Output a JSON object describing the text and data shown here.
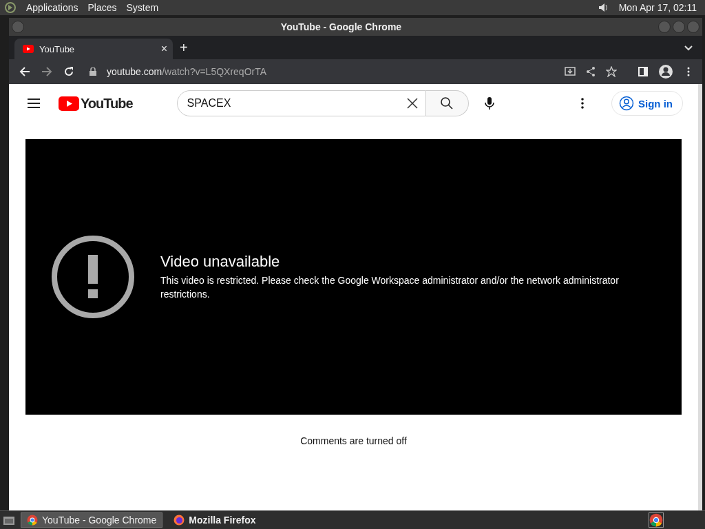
{
  "top_panel": {
    "menus": [
      "Applications",
      "Places",
      "System"
    ],
    "clock": "Mon Apr 17, 02:11"
  },
  "window": {
    "title": "YouTube - Google Chrome"
  },
  "tabs": [
    {
      "label": "YouTube",
      "selected": true,
      "close": "×"
    }
  ],
  "new_tab": "+",
  "address_bar": {
    "domain": "youtube.com",
    "path": "/watch?v=L5QXreqOrTA"
  },
  "youtube": {
    "logo": "YouTube",
    "search": {
      "value": "SPACEX"
    },
    "sign_in": "Sign in"
  },
  "player": {
    "title": "Video unavailable",
    "message": "This video is restricted. Please check the Google Workspace administrator and/or the network administrator restrictions."
  },
  "comments": "Comments are turned off",
  "taskbar": [
    {
      "label": "YouTube - Google Chrome",
      "selected": true,
      "kind": "chrome"
    },
    {
      "label": "Mozilla Firefox",
      "selected": false,
      "kind": "firefox"
    }
  ]
}
